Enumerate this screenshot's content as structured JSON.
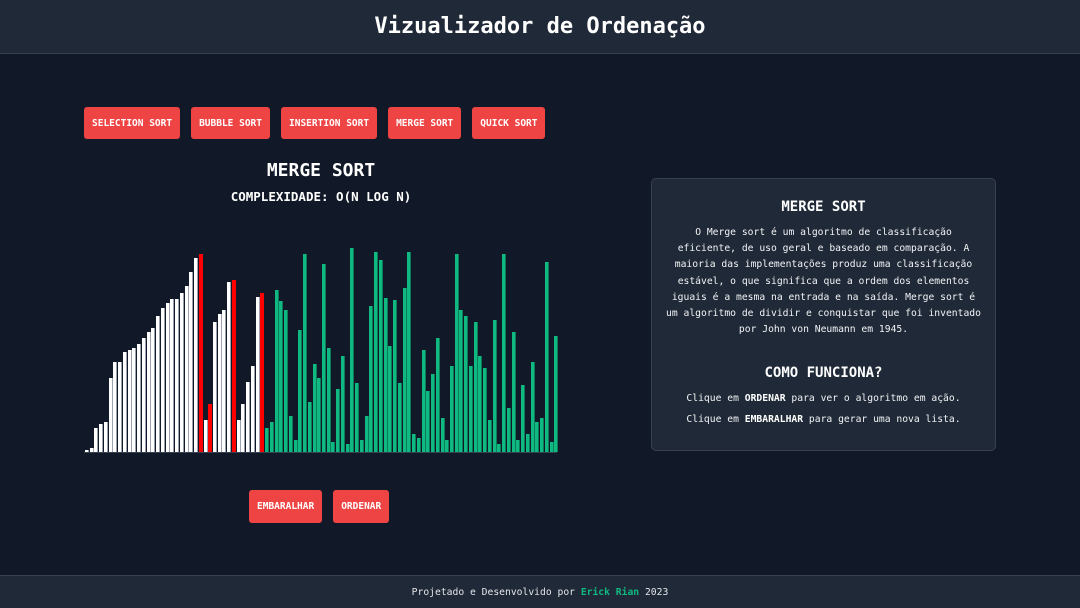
{
  "header": {
    "title": "Vizualizador de Ordenação"
  },
  "algorithms": [
    {
      "label": "SELECTION SORT"
    },
    {
      "label": "BUBBLE SORT"
    },
    {
      "label": "INSERTION SORT"
    },
    {
      "label": "MERGE SORT"
    },
    {
      "label": "QUICK SORT"
    }
  ],
  "visualizer": {
    "title": "MERGE SORT",
    "complexity": "COMPLEXIDADE: O(N LOG N)",
    "colors": {
      "sorted": "#ffffff",
      "active": "#ff0000",
      "unsorted": "#10b981"
    },
    "bars": [
      {
        "v": 2,
        "s": "white"
      },
      {
        "v": 4,
        "s": "white"
      },
      {
        "v": 24,
        "s": "white"
      },
      {
        "v": 28,
        "s": "white"
      },
      {
        "v": 30,
        "s": "white"
      },
      {
        "v": 73,
        "s": "white"
      },
      {
        "v": 89,
        "s": "white"
      },
      {
        "v": 89,
        "s": "white"
      },
      {
        "v": 99,
        "s": "white"
      },
      {
        "v": 101,
        "s": "white"
      },
      {
        "v": 103,
        "s": "white"
      },
      {
        "v": 107,
        "s": "white"
      },
      {
        "v": 113,
        "s": "white"
      },
      {
        "v": 119,
        "s": "white"
      },
      {
        "v": 123,
        "s": "white"
      },
      {
        "v": 135,
        "s": "white"
      },
      {
        "v": 143,
        "s": "white"
      },
      {
        "v": 148,
        "s": "white"
      },
      {
        "v": 152,
        "s": "white"
      },
      {
        "v": 152,
        "s": "white"
      },
      {
        "v": 158,
        "s": "white"
      },
      {
        "v": 164,
        "s": "white"
      },
      {
        "v": 178,
        "s": "white"
      },
      {
        "v": 192,
        "s": "white"
      },
      {
        "v": 196,
        "s": "red"
      },
      {
        "v": 32,
        "s": "white"
      },
      {
        "v": 48,
        "s": "red"
      },
      {
        "v": 129,
        "s": "white"
      },
      {
        "v": 137,
        "s": "white"
      },
      {
        "v": 141,
        "s": "white"
      },
      {
        "v": 168,
        "s": "white"
      },
      {
        "v": 170,
        "s": "red"
      },
      {
        "v": 32,
        "s": "white"
      },
      {
        "v": 48,
        "s": "white"
      },
      {
        "v": 69,
        "s": "white"
      },
      {
        "v": 85,
        "s": "white"
      },
      {
        "v": 154,
        "s": "white"
      },
      {
        "v": 158,
        "s": "red"
      },
      {
        "v": 24,
        "s": "green"
      },
      {
        "v": 30,
        "s": "green"
      },
      {
        "v": 160,
        "s": "green"
      },
      {
        "v": 150,
        "s": "green"
      },
      {
        "v": 141,
        "s": "green"
      },
      {
        "v": 36,
        "s": "green"
      },
      {
        "v": 12,
        "s": "green"
      },
      {
        "v": 121,
        "s": "green"
      },
      {
        "v": 196,
        "s": "green"
      },
      {
        "v": 50,
        "s": "green"
      },
      {
        "v": 87,
        "s": "green"
      },
      {
        "v": 73,
        "s": "green"
      },
      {
        "v": 186,
        "s": "green"
      },
      {
        "v": 103,
        "s": "green"
      },
      {
        "v": 10,
        "s": "green"
      },
      {
        "v": 62,
        "s": "green"
      },
      {
        "v": 95,
        "s": "green"
      },
      {
        "v": 8,
        "s": "green"
      },
      {
        "v": 202,
        "s": "green"
      },
      {
        "v": 68,
        "s": "green"
      },
      {
        "v": 12,
        "s": "green"
      },
      {
        "v": 36,
        "s": "green"
      },
      {
        "v": 145,
        "s": "green"
      },
      {
        "v": 198,
        "s": "green"
      },
      {
        "v": 190,
        "s": "green"
      },
      {
        "v": 153,
        "s": "green"
      },
      {
        "v": 105,
        "s": "green"
      },
      {
        "v": 151,
        "s": "green"
      },
      {
        "v": 68,
        "s": "green"
      },
      {
        "v": 162,
        "s": "green"
      },
      {
        "v": 198,
        "s": "green"
      },
      {
        "v": 18,
        "s": "green"
      },
      {
        "v": 14,
        "s": "green"
      },
      {
        "v": 101,
        "s": "green"
      },
      {
        "v": 60,
        "s": "green"
      },
      {
        "v": 77,
        "s": "green"
      },
      {
        "v": 113,
        "s": "green"
      },
      {
        "v": 34,
        "s": "green"
      },
      {
        "v": 12,
        "s": "green"
      },
      {
        "v": 85,
        "s": "green"
      },
      {
        "v": 196,
        "s": "green"
      },
      {
        "v": 141,
        "s": "green"
      },
      {
        "v": 135,
        "s": "green"
      },
      {
        "v": 85,
        "s": "green"
      },
      {
        "v": 129,
        "s": "green"
      },
      {
        "v": 95,
        "s": "green"
      },
      {
        "v": 83,
        "s": "green"
      },
      {
        "v": 32,
        "s": "green"
      },
      {
        "v": 131,
        "s": "green"
      },
      {
        "v": 8,
        "s": "green"
      },
      {
        "v": 196,
        "s": "green"
      },
      {
        "v": 44,
        "s": "green"
      },
      {
        "v": 119,
        "s": "green"
      },
      {
        "v": 12,
        "s": "green"
      },
      {
        "v": 66,
        "s": "green"
      },
      {
        "v": 18,
        "s": "green"
      },
      {
        "v": 89,
        "s": "green"
      },
      {
        "v": 30,
        "s": "green"
      },
      {
        "v": 34,
        "s": "green"
      },
      {
        "v": 188,
        "s": "green"
      },
      {
        "v": 10,
        "s": "green"
      },
      {
        "v": 115,
        "s": "green"
      }
    ],
    "max_value": 210
  },
  "actions": {
    "shuffle_label": "EMBARALHAR",
    "sort_label": "ORDENAR"
  },
  "info": {
    "title": "MERGE SORT",
    "description": "O Merge sort é um algoritmo de classificação eficiente, de uso geral e baseado em comparação. A maioria das implementações produz uma classificação estável, o que significa que a ordem dos elementos iguais é a mesma na entrada e na saída. Merge sort é um algoritmo de dividir e conquistar que foi inventado por John von Neumann em 1945.",
    "how_title": "COMO FUNCIONA?",
    "how_lines": [
      {
        "pre": "Clique em ",
        "bold": "ORDENAR",
        "post": " para ver o algoritmo em ação."
      },
      {
        "pre": "Clique em ",
        "bold": "EMBARALHAR",
        "post": " para gerar uma nova lista."
      }
    ]
  },
  "footer": {
    "prefix": "Projetado e Desenvolvido por ",
    "author": "Erick Rian",
    "year": " 2023",
    "author_color": "#10b981"
  }
}
